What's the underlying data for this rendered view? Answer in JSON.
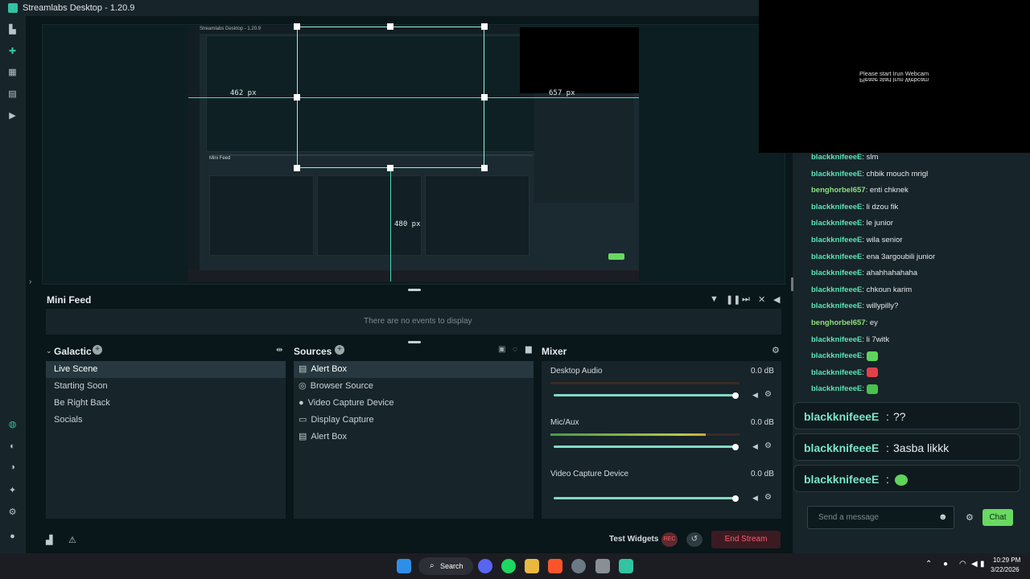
{
  "window": {
    "title": "Streamlabs Desktop - 1.20.9"
  },
  "preview": {
    "labels": {
      "left": "462 px",
      "right": "657 px",
      "bottom": "480 px"
    },
    "nested_title": "Streamlabs Desktop - 1.20.9",
    "nested_mini_feed": "Mini Feed"
  },
  "webcam": {
    "message": "Please start Irun Webcam"
  },
  "mini_feed": {
    "title": "Mini Feed",
    "empty": "There are no events to display"
  },
  "scenes": {
    "title": "Galactic",
    "items": [
      "Live Scene",
      "Starting Soon",
      "Be Right Back",
      "Socials"
    ],
    "selected": 0
  },
  "sources": {
    "title": "Sources",
    "items": [
      {
        "label": "Alert Box",
        "icon": "alert-box-icon"
      },
      {
        "label": "Browser Source",
        "icon": "globe-icon"
      },
      {
        "label": "Video Capture Device",
        "icon": "camera-icon"
      },
      {
        "label": "Display Capture",
        "icon": "monitor-icon"
      },
      {
        "label": "Alert Box",
        "icon": "alert-box-icon"
      }
    ]
  },
  "mixer": {
    "title": "Mixer",
    "channels": [
      {
        "name": "Desktop Audio",
        "db": "0.0 dB",
        "level": 0
      },
      {
        "name": "Mic/Aux",
        "db": "0.0 dB",
        "level": 0.7
      },
      {
        "name": "Video Capture Device",
        "db": "0.0 dB",
        "level": 0
      }
    ]
  },
  "footer": {
    "test_widgets": "Test Widgets",
    "rec": "REC",
    "end_stream": "End Stream"
  },
  "chat": {
    "lines": [
      {
        "user": "blackknifeeeE",
        "text": "slm"
      },
      {
        "user": "blackknifeeeE",
        "text": "chbik mouch mrigl"
      },
      {
        "user": "benghorbel657",
        "text": "enti chknek",
        "alt": true
      },
      {
        "user": "blackknifeeeE",
        "text": "li dzou fik"
      },
      {
        "user": "blackknifeeeE",
        "text": "le junior"
      },
      {
        "user": "blackknifeeeE",
        "text": "wila senior"
      },
      {
        "user": "blackknifeeeE",
        "text": "ena 3argoubili junior"
      },
      {
        "user": "blackknifeeeE",
        "text": "ahahhahahaha"
      },
      {
        "user": "blackknifeeeE",
        "text": "chkoun karim"
      },
      {
        "user": "blackknifeeeE",
        "text": "willypilly?"
      },
      {
        "user": "benghorbel657",
        "text": "ey",
        "alt": true
      },
      {
        "user": "blackknifeeeE",
        "text": "li 7witk"
      },
      {
        "user": "blackknifeeeE",
        "text": "",
        "emote": "#5fd35b"
      },
      {
        "user": "blackknifeeeE",
        "text": "",
        "emote": "#e0414a"
      },
      {
        "user": "blackknifeeeE",
        "text": "",
        "emote": "#49c24e"
      }
    ],
    "big": [
      {
        "user": "blackknifeeeE",
        "text": "??"
      },
      {
        "user": "blackknifeeeE",
        "text": "3asba likkk"
      },
      {
        "user": "blackknifeeeE",
        "text": "",
        "emote": "#5fd35b"
      }
    ],
    "input_placeholder": "Send a message",
    "send_label": "Chat"
  },
  "taskbar": {
    "search_label": "Search",
    "time": "10:29 PM",
    "date": "3/22/2026"
  },
  "colors": {
    "accent": "#31c3a2",
    "chat_green": "#68d961",
    "end_stream": "#ff5a6e"
  }
}
